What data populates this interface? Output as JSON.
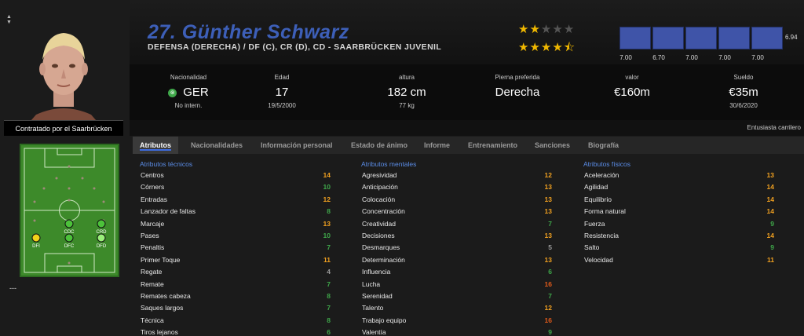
{
  "player": {
    "name": "27. Günther Schwarz",
    "positions": "DEFENSA (DERECHA) / DF (C), CR (D), CD - SAARBRÜCKEN JUVENIL",
    "current_ability_stars": 2,
    "potential_ability_stars": 4.5,
    "max_stars": 5,
    "contract_label": "Contratado por el Saarbrücken",
    "role_note": "Entusiasta carrilero",
    "dashes": "---"
  },
  "recent_ratings": {
    "values": [
      "7.00",
      "6.70",
      "7.00",
      "7.00",
      "7.00"
    ],
    "average": "6.94",
    "bar_color": "#3f54a8"
  },
  "info": [
    {
      "label": "Nacionalidad",
      "value": "GER",
      "sub": "No intern.",
      "icon": "nationality-icon"
    },
    {
      "label": "Edad",
      "value": "17",
      "sub": "19/5/2000"
    },
    {
      "label": "altura",
      "value": "182 cm",
      "sub": "77 kg"
    },
    {
      "label": "Pierna preferida",
      "value": "Derecha",
      "sub": ""
    },
    {
      "label": "valor",
      "value": "€160m",
      "sub": ""
    },
    {
      "label": "Sueldo",
      "value": "€35m",
      "sub": "30/6/2020"
    }
  ],
  "tabs": [
    "Atributos",
    "Nacionalidades",
    "Información personal",
    "Estado de ánimo",
    "Informe",
    "Entrenamiento",
    "Sanciones",
    "Biografía"
  ],
  "active_tab": "Atributos",
  "pitch_positions": [
    "CDC",
    "CRD",
    "DFI",
    "DFC",
    "DFD"
  ],
  "attributes": {
    "technical": {
      "title": "Atributos técnicos",
      "items": [
        {
          "name": "Centros",
          "value": "14"
        },
        {
          "name": "Córners",
          "value": "10"
        },
        {
          "name": "Entradas",
          "value": "12"
        },
        {
          "name": "Lanzador de faltas",
          "value": "8"
        },
        {
          "name": "Marcaje",
          "value": "13"
        },
        {
          "name": "Pases",
          "value": "10"
        },
        {
          "name": "Penaltis",
          "value": "7"
        },
        {
          "name": "Primer Toque",
          "value": "11"
        },
        {
          "name": "Regate",
          "value": "4"
        },
        {
          "name": "Remate",
          "value": "7"
        },
        {
          "name": "Remates cabeza",
          "value": "8"
        },
        {
          "name": "Saques largos",
          "value": "7"
        },
        {
          "name": "Técnica",
          "value": "8"
        },
        {
          "name": "Tiros lejanos",
          "value": "6"
        }
      ]
    },
    "mental": {
      "title": "Atributos mentales",
      "items": [
        {
          "name": "Agresividad",
          "value": "12"
        },
        {
          "name": "Anticipación",
          "value": "13"
        },
        {
          "name": "Colocación",
          "value": "13"
        },
        {
          "name": "Concentración",
          "value": "13"
        },
        {
          "name": "Creatividad",
          "value": "7"
        },
        {
          "name": "Decisiones",
          "value": "13"
        },
        {
          "name": "Desmarques",
          "value": "5"
        },
        {
          "name": "Determinación",
          "value": "13"
        },
        {
          "name": "Influencia",
          "value": "6"
        },
        {
          "name": "Lucha",
          "value": "16"
        },
        {
          "name": "Serenidad",
          "value": "7"
        },
        {
          "name": "Talento",
          "value": "12"
        },
        {
          "name": "Trabajo equipo",
          "value": "16"
        },
        {
          "name": "Valentía",
          "value": "9"
        }
      ]
    },
    "physical": {
      "title": "Atributos físicos",
      "items": [
        {
          "name": "Aceleración",
          "value": "13"
        },
        {
          "name": "Agilidad",
          "value": "14"
        },
        {
          "name": "Equilibrio",
          "value": "14"
        },
        {
          "name": "Forma natural",
          "value": "14"
        },
        {
          "name": "Fuerza",
          "value": "9"
        },
        {
          "name": "Resistencia",
          "value": "14"
        },
        {
          "name": "Salto",
          "value": "9"
        },
        {
          "name": "Velocidad",
          "value": "11"
        }
      ]
    }
  },
  "colors": {
    "name": "#3d5fb8",
    "accent_blue": "#5b8de8",
    "star": "#f0b800",
    "value_low": "#9a9a9a",
    "value_mid": "#3fa84a",
    "value_high": "#f0a020",
    "value_top": "#e05a1a"
  }
}
